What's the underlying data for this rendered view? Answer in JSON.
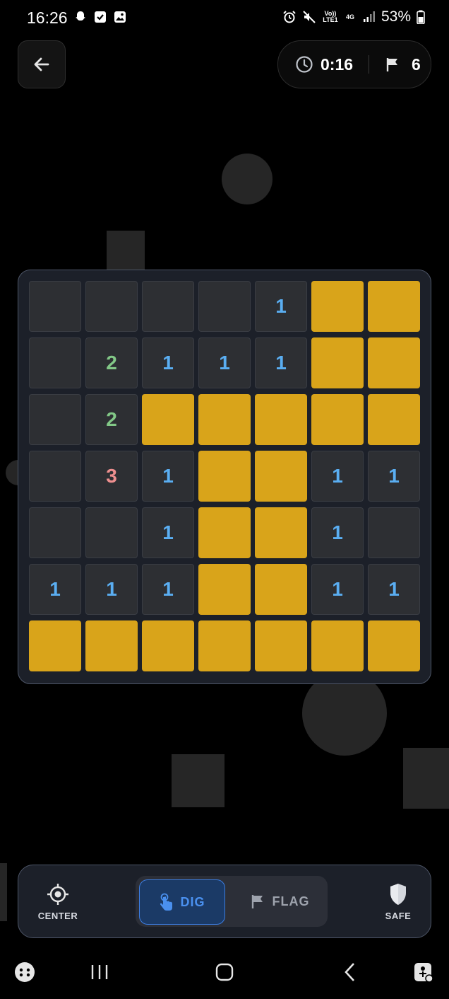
{
  "status_bar": {
    "time": "16:26",
    "battery": "53%",
    "left_icons": [
      "snapchat-icon",
      "checkbox-icon",
      "gallery-icon"
    ],
    "right_icons": [
      "alarm-icon",
      "mute-icon",
      "volte-icon",
      "4g-icon",
      "signal-icon",
      "battery-icon"
    ],
    "volte_text": "Vo)) LTE1",
    "network_text": "4G"
  },
  "hud": {
    "timer": "0:16",
    "flags": "6"
  },
  "board": {
    "rows": 7,
    "cols": 7,
    "cells": [
      [
        "",
        "",
        "",
        "",
        "1",
        "#",
        "#"
      ],
      [
        "",
        "2",
        "1",
        "1",
        "1",
        "#",
        "#"
      ],
      [
        "",
        "2",
        "#",
        "#",
        "#",
        "#",
        "#"
      ],
      [
        "",
        "3",
        "1",
        "#",
        "#",
        "1",
        "1"
      ],
      [
        "",
        "",
        "1",
        "#",
        "#",
        "1",
        ""
      ],
      [
        "1",
        "1",
        "1",
        "#",
        "#",
        "1",
        "1"
      ],
      [
        "#",
        "#",
        "#",
        "#",
        "#",
        "#",
        "#"
      ]
    ],
    "legend": {
      "#": "hidden",
      "": "revealed-empty"
    },
    "colors": {
      "hidden": "#d9a41a",
      "revealed": "#2d2f33",
      "n1": "#5aaef2",
      "n2": "#82c887",
      "n3": "#ee8f8f"
    }
  },
  "toolbar": {
    "center_label": "CENTER",
    "dig_label": "DIG",
    "flag_label": "FLAG",
    "safe_label": "SAFE",
    "active_mode": "DIG"
  },
  "nav": {
    "icons": [
      "game-launcher-icon",
      "recents-icon",
      "home-icon",
      "back-icon",
      "accessibility-icon"
    ]
  }
}
